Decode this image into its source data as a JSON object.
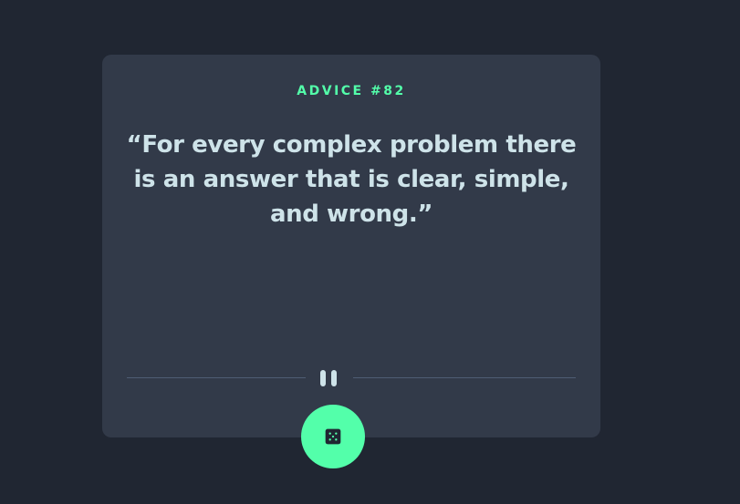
{
  "advice": {
    "id_label": "ADVICE #82",
    "quote": "“For every complex problem there is an answer that is clear, simple, and wrong.”"
  },
  "divider": {
    "icon": "pause-icon"
  },
  "dice_button": {
    "icon": "dice-icon"
  },
  "colors": {
    "background": "#202632",
    "card": "#323a49",
    "accent": "#53ffaa",
    "text": "#cee3e9",
    "divider": "#4f5d74"
  }
}
